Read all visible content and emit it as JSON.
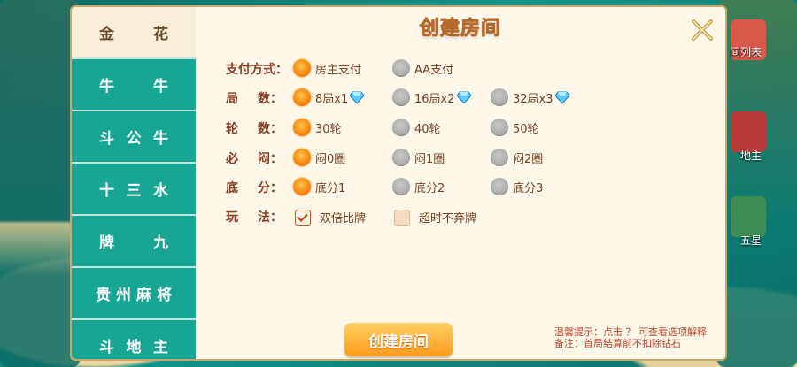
{
  "background": {
    "right_labels": [
      "间列表",
      "地主",
      "五星"
    ]
  },
  "menu": [
    {
      "chars": [
        "金",
        "花"
      ],
      "active": true
    },
    {
      "chars": [
        "牛",
        "牛"
      ],
      "active": false
    },
    {
      "chars": [
        "斗",
        "公",
        "牛"
      ],
      "active": false
    },
    {
      "chars": [
        "十",
        "三",
        "水"
      ],
      "active": false
    },
    {
      "chars": [
        "牌",
        "九"
      ],
      "active": false
    },
    {
      "chars": [
        "贵",
        "州",
        "麻",
        "将"
      ],
      "active": false
    },
    {
      "chars": [
        "斗",
        "地",
        "主"
      ],
      "active": false
    }
  ],
  "dialog": {
    "title": "创建房间",
    "rows": [
      {
        "label": [
          "支",
          "付",
          "方",
          "式："
        ],
        "options": [
          {
            "text": "房主支付",
            "selected": true
          },
          {
            "text": "AA支付",
            "selected": false
          }
        ]
      },
      {
        "label": [
          "局",
          "数："
        ],
        "options": [
          {
            "text": "8局x1",
            "selected": true,
            "diamond": true
          },
          {
            "text": "16局x2",
            "selected": false,
            "diamond": true
          },
          {
            "text": "32局x3",
            "selected": false,
            "diamond": true
          }
        ]
      },
      {
        "label": [
          "轮",
          "数："
        ],
        "options": [
          {
            "text": "30轮",
            "selected": true
          },
          {
            "text": "40轮",
            "selected": false
          },
          {
            "text": "50轮",
            "selected": false
          }
        ]
      },
      {
        "label": [
          "必",
          "闷："
        ],
        "options": [
          {
            "text": "闷0圈",
            "selected": true
          },
          {
            "text": "闷1圈",
            "selected": false
          },
          {
            "text": "闷2圈",
            "selected": false
          }
        ]
      },
      {
        "label": [
          "底",
          "分："
        ],
        "options": [
          {
            "text": "底分1",
            "selected": true
          },
          {
            "text": "底分2",
            "selected": false
          },
          {
            "text": "底分3",
            "selected": false
          }
        ]
      },
      {
        "label": [
          "玩",
          "法："
        ],
        "checkboxes": [
          {
            "text": "双倍比牌",
            "checked": true
          },
          {
            "text": "超时不弃牌",
            "checked": false
          }
        ]
      }
    ],
    "create_button": "创建房间",
    "tips": [
      "温馨提示：点击 ？  可查看选项解释",
      "备注：首局结算前不扣除钻石"
    ]
  },
  "colors": {
    "accent": "#ff8a12",
    "menu_bg": "#17a594",
    "label": "#8a3c22"
  }
}
